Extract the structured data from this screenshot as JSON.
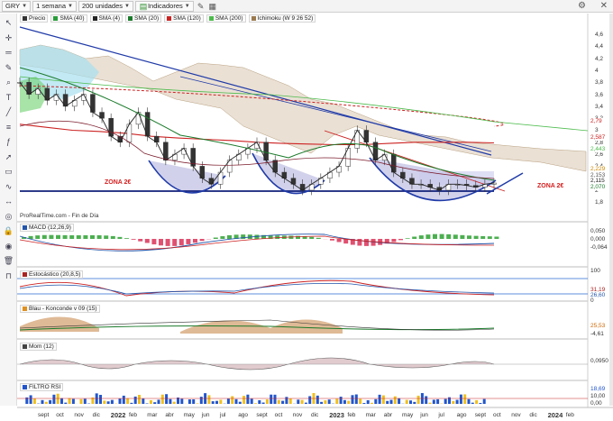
{
  "toolbar": {
    "symbol": "GRY",
    "timeframe": "1 semana",
    "units": "200 unidades",
    "indicators": "Indicadores"
  },
  "main_legend": [
    {
      "label": "Precio",
      "color": "#333333"
    },
    {
      "label": "SMA (40)",
      "color": "#2a9d3a"
    },
    {
      "label": "SMA (4)",
      "color": "#222222"
    },
    {
      "label": "SMA (20)",
      "color": "#1a7a2a"
    },
    {
      "label": "SMA (120)",
      "color": "#cc2222"
    },
    {
      "label": "SMA (200)",
      "color": "#4cbb4c"
    },
    {
      "label": "Ichimoku (W 9 26 52)",
      "color": "#9b7a50"
    }
  ],
  "source": "ProRealTime.com - Fin de Día",
  "zones": {
    "left": "ZONA 2€",
    "right": "ZONA 2€"
  },
  "price_axis": {
    "ticks": [
      "4,6",
      "4,4",
      "4,2",
      "4",
      "3,8",
      "3,6",
      "3,4",
      "3,2",
      "3",
      "2,8",
      "2,6",
      "2,4",
      "2,2",
      "2",
      "1,8"
    ],
    "tags": [
      {
        "text": "2,79",
        "color": "#cc2222"
      },
      {
        "text": "2,587",
        "color": "#cc2222"
      },
      {
        "text": "2,443",
        "color": "#4cbb4c"
      },
      {
        "text": "2,229",
        "color": "#cc8800"
      },
      {
        "text": "2,153",
        "color": "#555555"
      },
      {
        "text": "2,115",
        "color": "#222222"
      },
      {
        "text": "2,070",
        "color": "#1a7a2a"
      }
    ]
  },
  "panels": {
    "macd": {
      "title": "MACD (12,26,9)",
      "ticks": [
        "0,050",
        "0,000",
        "-0,064"
      ]
    },
    "stoch": {
      "title": "Estocástico (20,8,5)",
      "ticks": [
        "100",
        "0"
      ],
      "tags": [
        "31,19",
        "26,60"
      ]
    },
    "blau": {
      "title": "Blau - Konconde v 09 (15)",
      "ticks": [
        "25,53",
        "-4,61"
      ]
    },
    "mom": {
      "title": "Mom (12)",
      "ticks": [
        "0,0950"
      ]
    },
    "rsi": {
      "title": "FILTRO RSI",
      "ticks": [
        "18,69",
        "10,00",
        "0,00"
      ]
    }
  },
  "x_axis": [
    {
      "label": "sept",
      "year": false
    },
    {
      "label": "oct",
      "year": false
    },
    {
      "label": "nov",
      "year": false
    },
    {
      "label": "dic",
      "year": false
    },
    {
      "label": "2022",
      "year": true
    },
    {
      "label": "feb",
      "year": false
    },
    {
      "label": "mar",
      "year": false
    },
    {
      "label": "abr",
      "year": false
    },
    {
      "label": "may",
      "year": false
    },
    {
      "label": "jun",
      "year": false
    },
    {
      "label": "jul",
      "year": false
    },
    {
      "label": "ago",
      "year": false
    },
    {
      "label": "sept",
      "year": false
    },
    {
      "label": "oct",
      "year": false
    },
    {
      "label": "nov",
      "year": false
    },
    {
      "label": "dic",
      "year": false
    },
    {
      "label": "2023",
      "year": true
    },
    {
      "label": "feb",
      "year": false
    },
    {
      "label": "mar",
      "year": false
    },
    {
      "label": "abr",
      "year": false
    },
    {
      "label": "may",
      "year": false
    },
    {
      "label": "jun",
      "year": false
    },
    {
      "label": "jul",
      "year": false
    },
    {
      "label": "ago",
      "year": false
    },
    {
      "label": "sept",
      "year": false
    },
    {
      "label": "oct",
      "year": false
    },
    {
      "label": "nov",
      "year": false
    },
    {
      "label": "dic",
      "year": false
    },
    {
      "label": "2024",
      "year": true
    },
    {
      "label": "feb",
      "year": false
    }
  ],
  "sidebar_icons": [
    "cursor-icon",
    "crosshair-icon",
    "ruler-icon",
    "pencil-icon",
    "zoom-icon",
    "text-icon",
    "line-icon",
    "channel-icon",
    "fibonacci-icon",
    "arrow-icon",
    "shape-icon",
    "wave-icon",
    "measure-icon",
    "target-icon",
    "lock-icon",
    "eye-icon",
    "trash-icon",
    "magnet-icon"
  ],
  "chart_data": {
    "type": "line",
    "series": [
      {
        "name": "Precio",
        "values": [
          3.8,
          3.6,
          3.7,
          3.5,
          3.6,
          3.4,
          3.5,
          3.6,
          3.3,
          3.2,
          2.9,
          2.8,
          3.1,
          3.3,
          2.9,
          2.8,
          2.5,
          2.6,
          2.7,
          2.4,
          2.2,
          2.1,
          2.3,
          2.5,
          2.6,
          2.7,
          2.8,
          2.5,
          2.3,
          2.2,
          2.1,
          2.0,
          2.1,
          2.2,
          2.3,
          2.4,
          2.7,
          3.0,
          2.8,
          2.5,
          2.6,
          2.3,
          2.2,
          2.1,
          2.1,
          2.05,
          2.0,
          2.1,
          2.1,
          2.08,
          2.05,
          2.1,
          2.12
        ]
      },
      {
        "name": "SMA (120)",
        "values": [
          3.1,
          3.05,
          3.0,
          2.98,
          2.95,
          2.9,
          2.87,
          2.85,
          2.83,
          2.8,
          2.78,
          2.77,
          2.76,
          2.76,
          2.78,
          2.8,
          2.8,
          2.8,
          2.79
        ]
      }
    ]
  }
}
